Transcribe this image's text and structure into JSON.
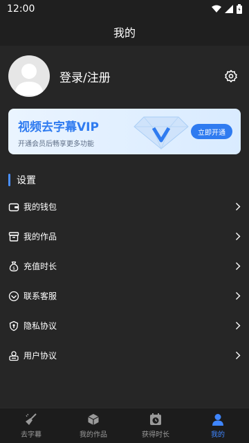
{
  "status_bar": {
    "time": "12:00"
  },
  "header": {
    "title": "我的"
  },
  "profile": {
    "login_label": "登录/注册"
  },
  "vip": {
    "title": "视频去字幕VIP",
    "subtitle": "开通会员后畅享更多功能",
    "button_label": "立即开通"
  },
  "settings": {
    "section_title": "设置",
    "items": [
      {
        "label": "我的钱包",
        "icon": "wallet-icon"
      },
      {
        "label": "我的作品",
        "icon": "works-icon"
      },
      {
        "label": "充值时长",
        "icon": "money-bag-icon"
      },
      {
        "label": "联系客服",
        "icon": "heart-chat-icon"
      },
      {
        "label": "隐私协议",
        "icon": "shield-icon"
      },
      {
        "label": "用户协议",
        "icon": "user-doc-icon"
      }
    ]
  },
  "bottom_nav": {
    "items": [
      {
        "label": "去字幕",
        "icon": "broom-icon",
        "active": false
      },
      {
        "label": "我的作品",
        "icon": "box-icon",
        "active": false
      },
      {
        "label": "获得时长",
        "icon": "clock-icon",
        "active": false
      },
      {
        "label": "我的",
        "icon": "person-icon",
        "active": true
      }
    ]
  },
  "colors": {
    "accent": "#3f86ff",
    "background": "#262626",
    "bar": "#1f1f1f"
  }
}
